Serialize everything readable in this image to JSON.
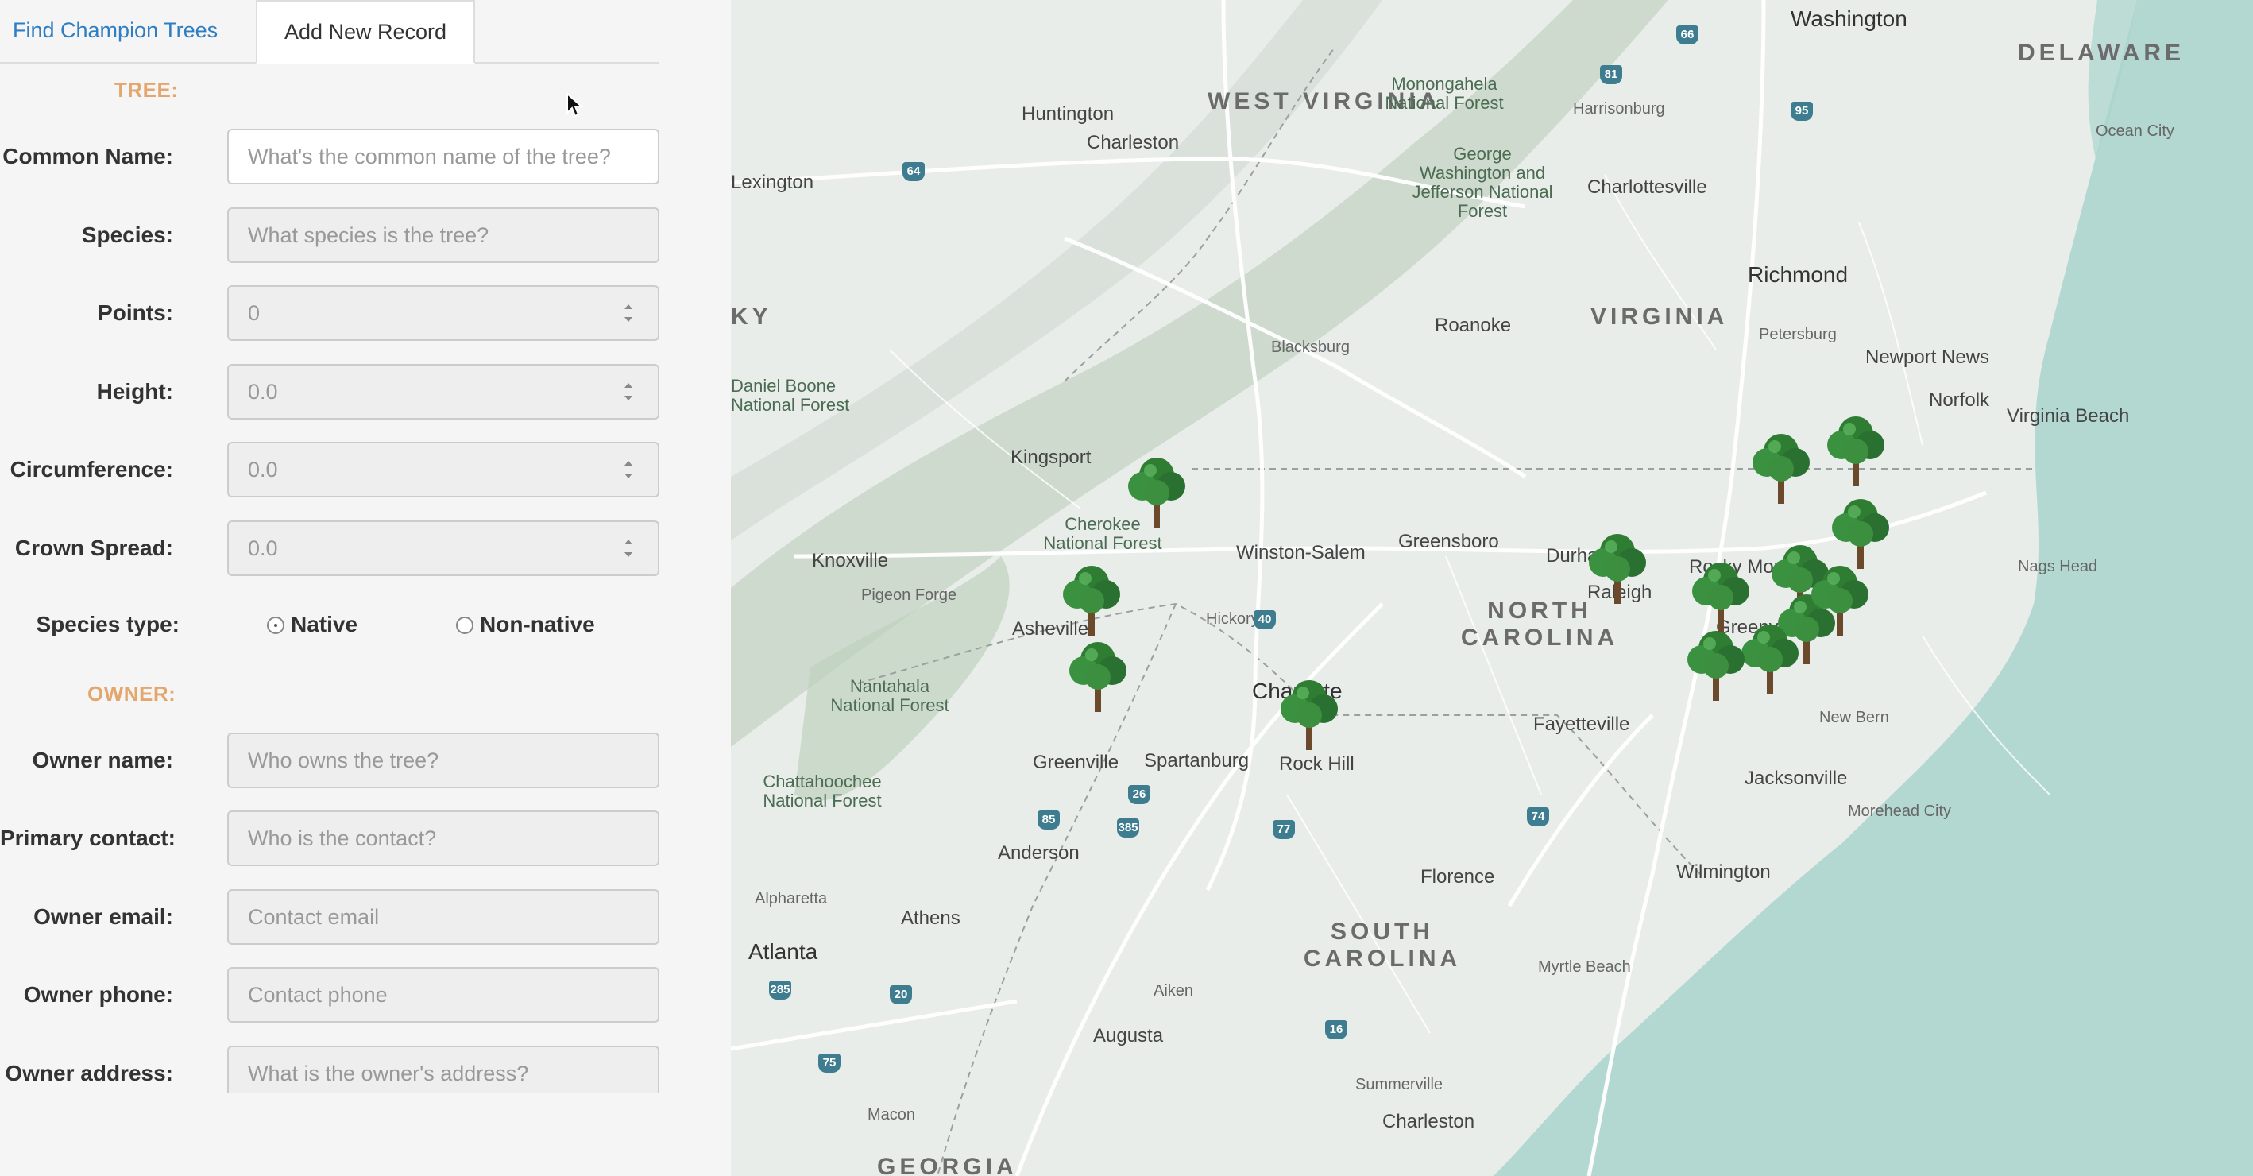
{
  "tabs": [
    {
      "label": "Find Champion Trees",
      "active": false
    },
    {
      "label": "Add New Record",
      "active": true
    }
  ],
  "form": {
    "tree_section": "TREE:",
    "owner_section": "OWNER:",
    "fields": {
      "common_name": {
        "label": "Common Name:",
        "placeholder": "What's the common name of the tree?"
      },
      "species": {
        "label": "Species:",
        "placeholder": "What species is the tree?"
      },
      "points": {
        "label": "Points:",
        "value": "0"
      },
      "height": {
        "label": "Height:",
        "value": "0.0"
      },
      "circumference": {
        "label": "Circumference:",
        "value": "0.0"
      },
      "crown_spread": {
        "label": "Crown Spread:",
        "value": "0.0"
      },
      "owner_name": {
        "label": "Owner name:",
        "placeholder": "Who owns the tree?"
      },
      "primary_contact": {
        "label": "Primary contact:",
        "placeholder": "Who is the contact?"
      },
      "owner_email": {
        "label": "Owner email:",
        "placeholder": "Contact email"
      },
      "owner_phone": {
        "label": "Owner phone:",
        "placeholder": "Contact phone"
      },
      "owner_address": {
        "label": "Owner address:",
        "placeholder": "What is the owner's address?"
      }
    },
    "species_type": {
      "label": "Species type:",
      "options": [
        "Native",
        "Non-native"
      ],
      "selected": "Native"
    }
  },
  "map": {
    "colors": {
      "land": "#e9edea",
      "water": "#a9d4cd",
      "mountain": "#cbd9cc",
      "road": "#ffffff",
      "border": "#9aa0a0",
      "marker": "#2e8b2e"
    },
    "labels": {
      "states": [
        "WEST VIRGINIA",
        "VIRGINIA",
        "NORTH CAROLINA",
        "SOUTH CAROLINA",
        "DELAWARE",
        "GEORGIA",
        "KY"
      ],
      "cities": [
        "Washington",
        "Huntington",
        "Charleston",
        "Lexington",
        "Harrisonburg",
        "Charlottesville",
        "Richmond",
        "Petersburg",
        "Newport News",
        "Norfolk",
        "Virginia Beach",
        "Ocean City",
        "Roanoke",
        "Blacksburg",
        "Kingsport",
        "Knoxville",
        "Pigeon Forge",
        "Asheville",
        "Hickory",
        "Winston-Salem",
        "Greensboro",
        "Durham",
        "Raleigh",
        "Rocky Mount",
        "Greenville",
        "Nags Head",
        "New Bern",
        "Jacksonville",
        "Morehead City",
        "Wilmington",
        "Fayetteville",
        "Charlotte",
        "Rock Hill",
        "Spartanburg",
        "Greenville",
        "Anderson",
        "Alpharetta",
        "Athens",
        "Atlanta",
        "Augusta",
        "Aiken",
        "Florence",
        "Myrtle Beach",
        "Summerville",
        "Charleston",
        "Macon"
      ],
      "parks": [
        "Monongahela National Forest",
        "George Washington and Jefferson National Forest",
        "Daniel Boone National Forest",
        "Cherokee National Forest",
        "Nantahala National Forest",
        "Chattahoochee National Forest"
      ],
      "highways": [
        "64",
        "81",
        "66",
        "95",
        "77",
        "85",
        "40",
        "26",
        "385",
        "74",
        "20",
        "285",
        "75",
        "16"
      ]
    },
    "tree_marker_count": 14
  }
}
